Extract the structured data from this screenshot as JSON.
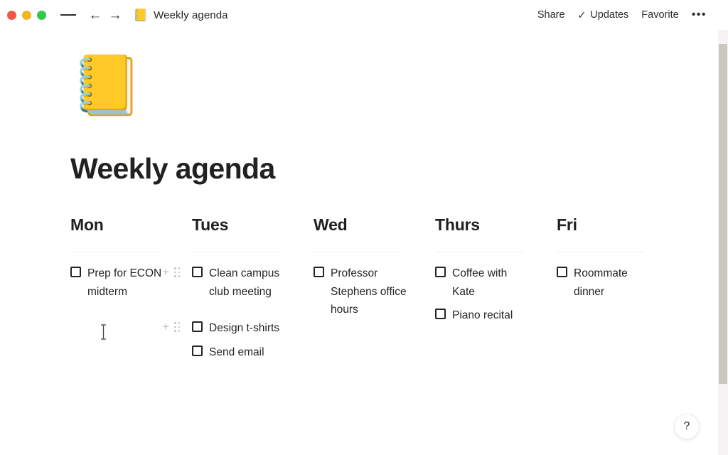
{
  "window": {
    "controls": [
      {
        "name": "close",
        "color": "#f1564b"
      },
      {
        "name": "minimize",
        "color": "#f5b426"
      },
      {
        "name": "maximize",
        "color": "#33c848"
      }
    ]
  },
  "toolbar": {
    "menu_icon": "hamburger-icon",
    "back_icon": "←",
    "forward_icon": "→",
    "breadcrumb_emoji": "📒",
    "breadcrumb_title": "Weekly agenda",
    "share_label": "Share",
    "updates_check": "✓",
    "updates_label": "Updates",
    "favorite_label": "Favorite",
    "more_label": "•••"
  },
  "page": {
    "cover_emoji": "📒",
    "title": "Weekly agenda"
  },
  "columns": [
    {
      "day": "Mon",
      "items": [
        {
          "label": "Prep for ECON midterm",
          "checked": false
        }
      ]
    },
    {
      "day": "Tues",
      "items": [
        {
          "label": "Clean campus club meeting",
          "checked": false
        },
        {
          "label": "Design t-shirts",
          "checked": false
        },
        {
          "label": "Send email",
          "checked": false
        }
      ]
    },
    {
      "day": "Wed",
      "items": [
        {
          "label": "Professor Stephens office hours",
          "checked": false
        }
      ]
    },
    {
      "day": "Thurs",
      "items": [
        {
          "label": "Coffee with Kate",
          "checked": false
        },
        {
          "label": "Piano recital",
          "checked": false
        }
      ]
    },
    {
      "day": "Fri",
      "items": [
        {
          "label": "Roommate dinner",
          "checked": false
        }
      ]
    }
  ],
  "block_handles": {
    "plus_label": "+",
    "drag_label": "∷"
  },
  "help": {
    "label": "?"
  },
  "colors": {
    "text": "#242424",
    "muted": "#c4c4c4",
    "rule": "#ececec",
    "scroll_thumb": "#cac7c0",
    "scroll_track": "#f7f3f4"
  }
}
